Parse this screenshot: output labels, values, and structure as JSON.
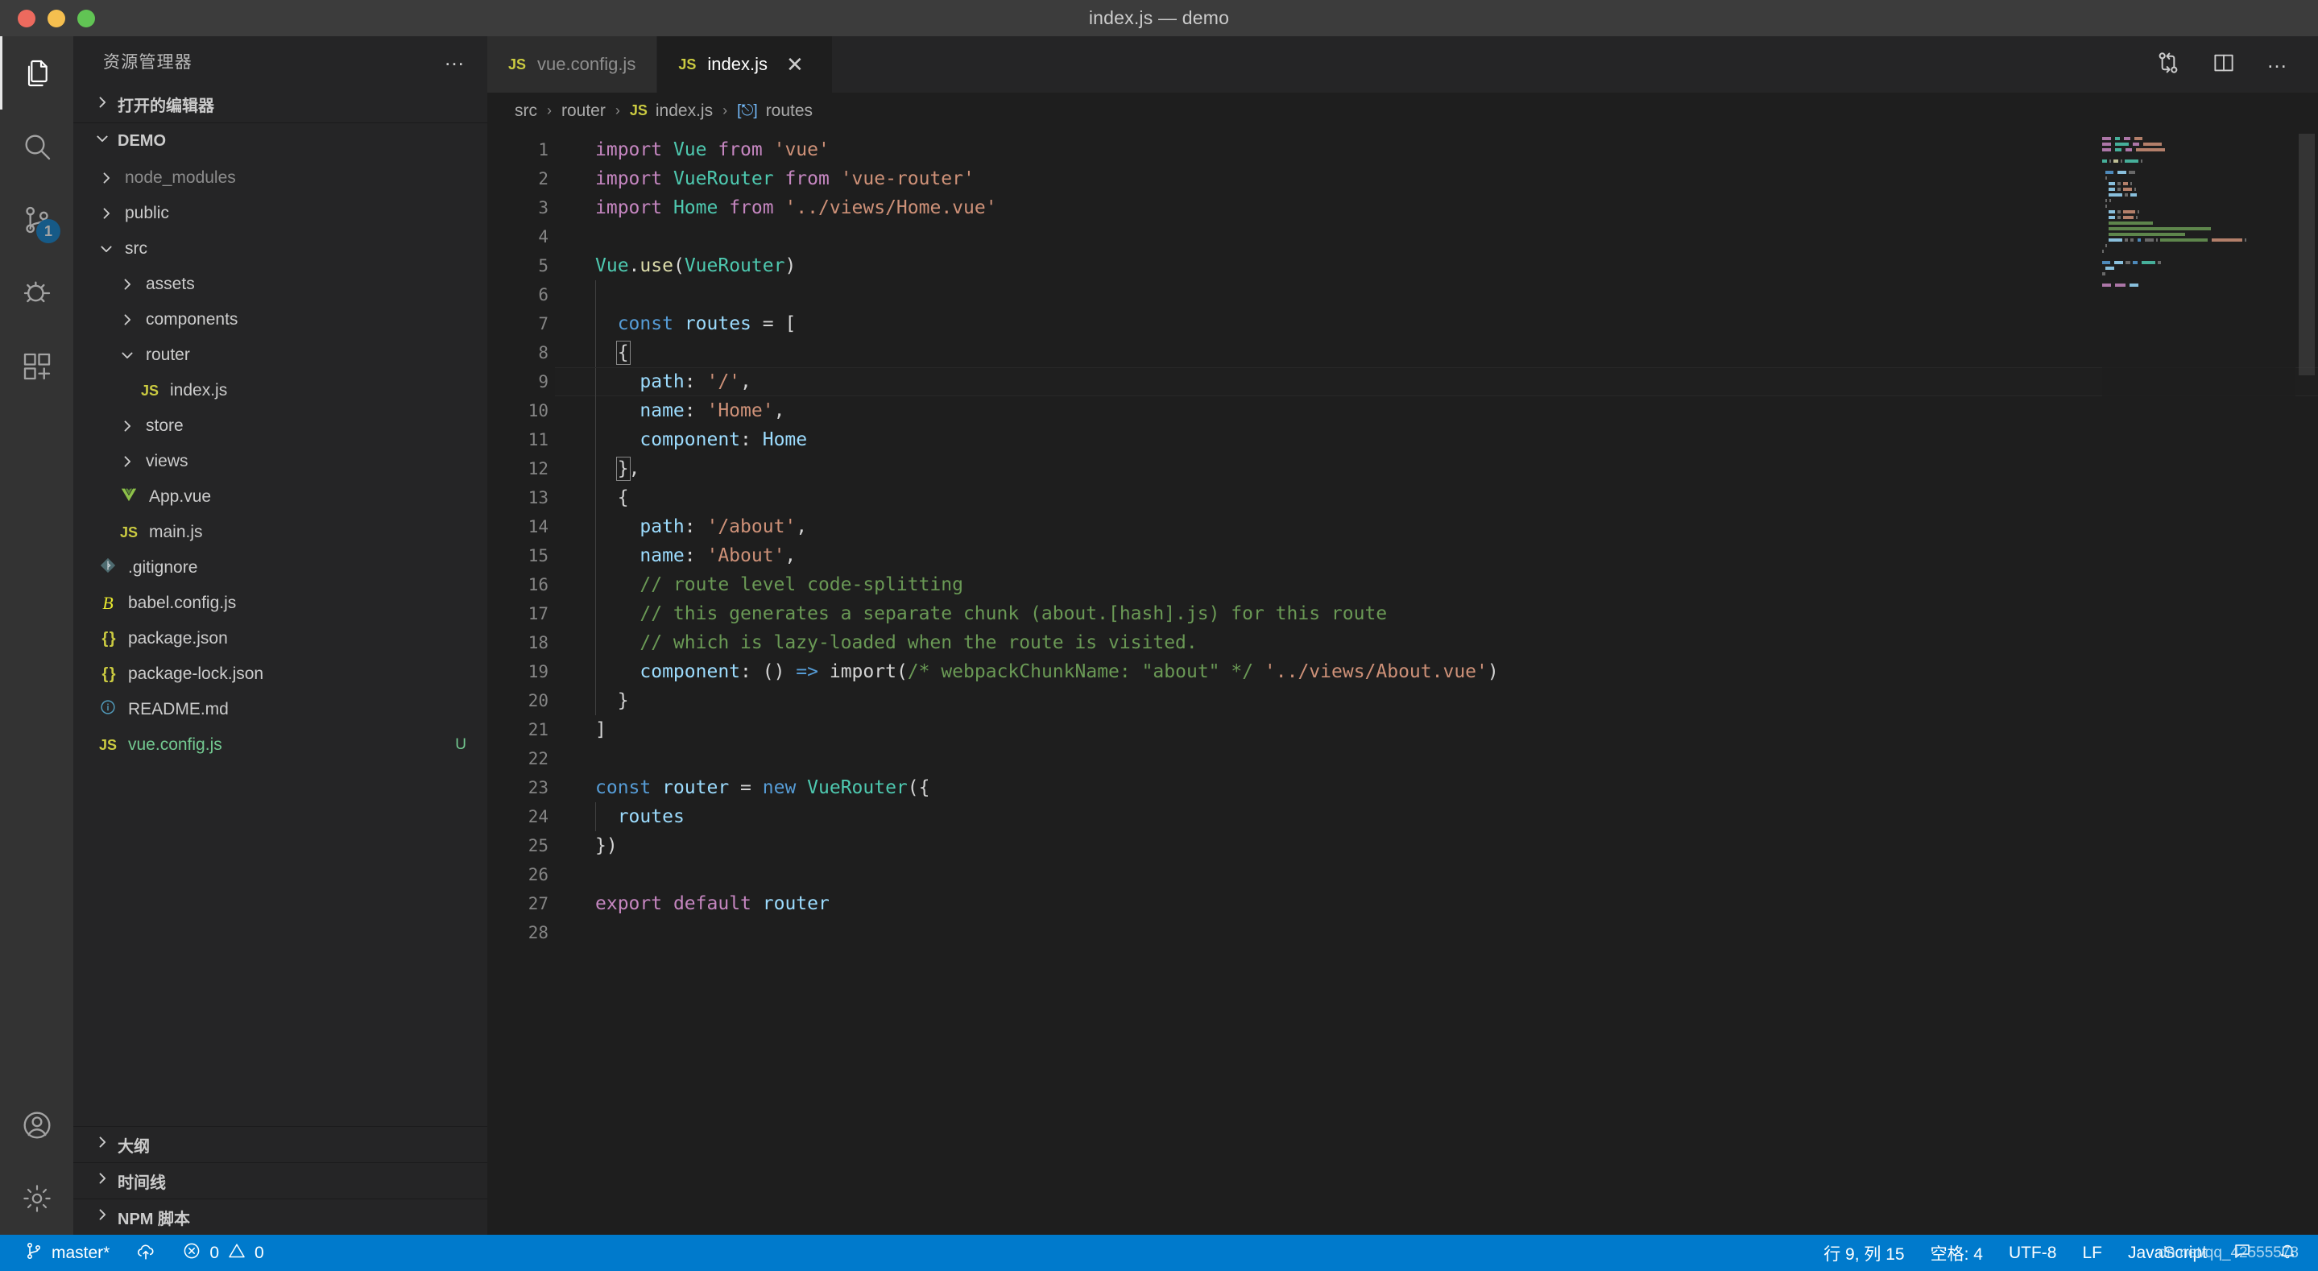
{
  "window": {
    "title": "index.js — demo",
    "traffic_lights": [
      "close-red",
      "minimize-yellow",
      "zoom-green"
    ]
  },
  "activity_bar": {
    "items": [
      {
        "name": "explorer",
        "icon": "files-icon",
        "active": true,
        "badge": null
      },
      {
        "name": "search",
        "icon": "search-icon",
        "active": false,
        "badge": null
      },
      {
        "name": "source-control",
        "icon": "source-control-icon",
        "active": false,
        "badge": "1"
      },
      {
        "name": "run-and-debug",
        "icon": "debug-icon",
        "active": false,
        "badge": null
      },
      {
        "name": "extensions",
        "icon": "extensions-icon",
        "active": false,
        "badge": null
      },
      {
        "name": "accounts",
        "icon": "account-icon",
        "active": false,
        "badge": null
      },
      {
        "name": "manage-settings",
        "icon": "gear-icon",
        "active": false,
        "badge": null
      }
    ]
  },
  "sidebar": {
    "title": "资源管理器",
    "more_actions": "…",
    "open_editors_label": "打开的编辑器",
    "project_label": "DEMO",
    "tree": [
      {
        "label": "node_modules",
        "depth": 1,
        "type": "folder",
        "expanded": false,
        "dim": true,
        "icon": "chevron-right-icon",
        "git": ""
      },
      {
        "label": "public",
        "depth": 1,
        "type": "folder",
        "expanded": false,
        "dim": false,
        "icon": "chevron-right-icon",
        "git": ""
      },
      {
        "label": "src",
        "depth": 1,
        "type": "folder",
        "expanded": true,
        "dim": false,
        "icon": "chevron-down-icon",
        "git": ""
      },
      {
        "label": "assets",
        "depth": 2,
        "type": "folder",
        "expanded": false,
        "dim": false,
        "icon": "chevron-right-icon",
        "git": ""
      },
      {
        "label": "components",
        "depth": 2,
        "type": "folder",
        "expanded": false,
        "dim": false,
        "icon": "chevron-right-icon",
        "git": ""
      },
      {
        "label": "router",
        "depth": 2,
        "type": "folder",
        "expanded": true,
        "dim": false,
        "icon": "chevron-down-icon",
        "git": ""
      },
      {
        "label": "index.js",
        "depth": 3,
        "type": "file",
        "expanded": false,
        "dim": false,
        "icon": "js-file-icon",
        "git": ""
      },
      {
        "label": "store",
        "depth": 2,
        "type": "folder",
        "expanded": false,
        "dim": false,
        "icon": "chevron-right-icon",
        "git": ""
      },
      {
        "label": "views",
        "depth": 2,
        "type": "folder",
        "expanded": false,
        "dim": false,
        "icon": "chevron-right-icon",
        "git": ""
      },
      {
        "label": "App.vue",
        "depth": 2,
        "type": "file",
        "expanded": false,
        "dim": false,
        "icon": "vue-file-icon",
        "git": ""
      },
      {
        "label": "main.js",
        "depth": 2,
        "type": "file",
        "expanded": false,
        "dim": false,
        "icon": "js-file-icon",
        "git": ""
      },
      {
        "label": ".gitignore",
        "depth": 1,
        "type": "file",
        "expanded": false,
        "dim": false,
        "icon": "git-file-icon",
        "git": ""
      },
      {
        "label": "babel.config.js",
        "depth": 1,
        "type": "file",
        "expanded": false,
        "dim": false,
        "icon": "babel-file-icon",
        "git": ""
      },
      {
        "label": "package.json",
        "depth": 1,
        "type": "file",
        "expanded": false,
        "dim": false,
        "icon": "json-file-icon",
        "git": ""
      },
      {
        "label": "package-lock.json",
        "depth": 1,
        "type": "file",
        "expanded": false,
        "dim": false,
        "icon": "json-file-icon",
        "git": ""
      },
      {
        "label": "README.md",
        "depth": 1,
        "type": "file",
        "expanded": false,
        "dim": false,
        "icon": "markdown-file-icon",
        "git": ""
      },
      {
        "label": "vue.config.js",
        "depth": 1,
        "type": "file",
        "expanded": false,
        "dim": false,
        "icon": "js-file-icon",
        "git": "U",
        "untracked": true
      }
    ],
    "bottom_sections": [
      {
        "label": "大纲"
      },
      {
        "label": "时间线"
      },
      {
        "label": "NPM 脚本"
      }
    ]
  },
  "editor": {
    "tabs": [
      {
        "label": "vue.config.js",
        "icon": "js-file-icon",
        "active": false,
        "closable": false
      },
      {
        "label": "index.js",
        "icon": "js-file-icon",
        "active": true,
        "closable": true,
        "close_glyph": "✕"
      }
    ],
    "actions": [
      {
        "name": "split-diff-icon"
      },
      {
        "name": "split-editor-icon"
      },
      {
        "name": "more-actions-icon",
        "glyph": "…"
      }
    ],
    "breadcrumb": [
      {
        "label": "src",
        "icon": null
      },
      {
        "label": "router",
        "icon": null
      },
      {
        "label": "index.js",
        "icon": "js-file-icon"
      },
      {
        "label": "routes",
        "icon": "symbol-variable-icon"
      }
    ],
    "breadcrumb_separator": "›",
    "current_line": 9,
    "lines": [
      {
        "n": 1,
        "indent": 0,
        "tokens": [
          {
            "t": "import",
            "c": "kw"
          },
          {
            "t": " ",
            "c": "pun"
          },
          {
            "t": "Vue",
            "c": "type"
          },
          {
            "t": " ",
            "c": "pun"
          },
          {
            "t": "from",
            "c": "kw"
          },
          {
            "t": " ",
            "c": "pun"
          },
          {
            "t": "'vue'",
            "c": "str"
          }
        ]
      },
      {
        "n": 2,
        "indent": 0,
        "tokens": [
          {
            "t": "import",
            "c": "kw"
          },
          {
            "t": " ",
            "c": "pun"
          },
          {
            "t": "VueRouter",
            "c": "type"
          },
          {
            "t": " ",
            "c": "pun"
          },
          {
            "t": "from",
            "c": "kw"
          },
          {
            "t": " ",
            "c": "pun"
          },
          {
            "t": "'vue-router'",
            "c": "str"
          }
        ]
      },
      {
        "n": 3,
        "indent": 0,
        "tokens": [
          {
            "t": "import",
            "c": "kw"
          },
          {
            "t": " ",
            "c": "pun"
          },
          {
            "t": "Home",
            "c": "type"
          },
          {
            "t": " ",
            "c": "pun"
          },
          {
            "t": "from",
            "c": "kw"
          },
          {
            "t": " ",
            "c": "pun"
          },
          {
            "t": "'../views/Home.vue'",
            "c": "str"
          }
        ]
      },
      {
        "n": 4,
        "indent": 0,
        "tokens": []
      },
      {
        "n": 5,
        "indent": 0,
        "tokens": [
          {
            "t": "Vue",
            "c": "type"
          },
          {
            "t": ".",
            "c": "pun"
          },
          {
            "t": "use",
            "c": "fn"
          },
          {
            "t": "(",
            "c": "pun"
          },
          {
            "t": "VueRouter",
            "c": "type"
          },
          {
            "t": ")",
            "c": "pun"
          }
        ]
      },
      {
        "n": 6,
        "indent": 1,
        "tokens": []
      },
      {
        "n": 7,
        "indent": 1,
        "tokens": [
          {
            "t": "  ",
            "c": "pun"
          },
          {
            "t": "const",
            "c": "blue"
          },
          {
            "t": " ",
            "c": "pun"
          },
          {
            "t": "routes",
            "c": "var"
          },
          {
            "t": " = [",
            "c": "pun"
          }
        ]
      },
      {
        "n": 8,
        "indent": 1,
        "tokens": [
          {
            "t": "  ",
            "c": "pun"
          },
          {
            "t": "{",
            "c": "pun",
            "bracket": true
          }
        ]
      },
      {
        "n": 9,
        "indent": 1,
        "tokens": [
          {
            "t": "    ",
            "c": "pun"
          },
          {
            "t": "path",
            "c": "var"
          },
          {
            "t": ": ",
            "c": "pun"
          },
          {
            "t": "'/'",
            "c": "str"
          },
          {
            "t": ",",
            "c": "pun"
          }
        ]
      },
      {
        "n": 10,
        "indent": 1,
        "tokens": [
          {
            "t": "    ",
            "c": "pun"
          },
          {
            "t": "name",
            "c": "var"
          },
          {
            "t": ": ",
            "c": "pun"
          },
          {
            "t": "'Home'",
            "c": "str"
          },
          {
            "t": ",",
            "c": "pun"
          }
        ]
      },
      {
        "n": 11,
        "indent": 1,
        "tokens": [
          {
            "t": "    ",
            "c": "pun"
          },
          {
            "t": "component",
            "c": "var"
          },
          {
            "t": ": ",
            "c": "pun"
          },
          {
            "t": "Home",
            "c": "var"
          }
        ]
      },
      {
        "n": 12,
        "indent": 1,
        "tokens": [
          {
            "t": "  ",
            "c": "pun"
          },
          {
            "t": "}",
            "c": "pun",
            "bracket": true
          },
          {
            "t": ",",
            "c": "pun"
          }
        ]
      },
      {
        "n": 13,
        "indent": 1,
        "tokens": [
          {
            "t": "  ",
            "c": "pun"
          },
          {
            "t": "{",
            "c": "pun"
          }
        ]
      },
      {
        "n": 14,
        "indent": 1,
        "tokens": [
          {
            "t": "    ",
            "c": "pun"
          },
          {
            "t": "path",
            "c": "var"
          },
          {
            "t": ": ",
            "c": "pun"
          },
          {
            "t": "'/about'",
            "c": "str"
          },
          {
            "t": ",",
            "c": "pun"
          }
        ]
      },
      {
        "n": 15,
        "indent": 1,
        "tokens": [
          {
            "t": "    ",
            "c": "pun"
          },
          {
            "t": "name",
            "c": "var"
          },
          {
            "t": ": ",
            "c": "pun"
          },
          {
            "t": "'About'",
            "c": "str"
          },
          {
            "t": ",",
            "c": "pun"
          }
        ]
      },
      {
        "n": 16,
        "indent": 1,
        "tokens": [
          {
            "t": "    ",
            "c": "pun"
          },
          {
            "t": "// route level code-splitting",
            "c": "cmt"
          }
        ]
      },
      {
        "n": 17,
        "indent": 1,
        "tokens": [
          {
            "t": "    ",
            "c": "pun"
          },
          {
            "t": "// this generates a separate chunk (about.[hash].js) for this route",
            "c": "cmt"
          }
        ]
      },
      {
        "n": 18,
        "indent": 1,
        "tokens": [
          {
            "t": "    ",
            "c": "pun"
          },
          {
            "t": "// which is lazy-loaded when the route is visited.",
            "c": "cmt"
          }
        ]
      },
      {
        "n": 19,
        "indent": 1,
        "tokens": [
          {
            "t": "    ",
            "c": "pun"
          },
          {
            "t": "component",
            "c": "var"
          },
          {
            "t": ": ",
            "c": "pun"
          },
          {
            "t": "()",
            "c": "pun"
          },
          {
            "t": " ",
            "c": "pun"
          },
          {
            "t": "=>",
            "c": "arrow"
          },
          {
            "t": " ",
            "c": "pun"
          },
          {
            "t": "import",
            "c": "pun"
          },
          {
            "t": "(",
            "c": "pun"
          },
          {
            "t": "/* webpackChunkName: \"about\" */",
            "c": "cmt"
          },
          {
            "t": " ",
            "c": "pun"
          },
          {
            "t": "'../views/About.vue'",
            "c": "str"
          },
          {
            "t": ")",
            "c": "pun"
          }
        ]
      },
      {
        "n": 20,
        "indent": 1,
        "tokens": [
          {
            "t": "  ",
            "c": "pun"
          },
          {
            "t": "}",
            "c": "pun"
          }
        ]
      },
      {
        "n": 21,
        "indent": 0,
        "tokens": [
          {
            "t": "]",
            "c": "pun"
          }
        ]
      },
      {
        "n": 22,
        "indent": 0,
        "tokens": []
      },
      {
        "n": 23,
        "indent": 0,
        "tokens": [
          {
            "t": "const",
            "c": "blue"
          },
          {
            "t": " ",
            "c": "pun"
          },
          {
            "t": "router",
            "c": "var"
          },
          {
            "t": " = ",
            "c": "pun"
          },
          {
            "t": "new",
            "c": "blue"
          },
          {
            "t": " ",
            "c": "pun"
          },
          {
            "t": "VueRouter",
            "c": "type"
          },
          {
            "t": "({",
            "c": "pun"
          }
        ]
      },
      {
        "n": 24,
        "indent": 1,
        "tokens": [
          {
            "t": "  ",
            "c": "pun"
          },
          {
            "t": "routes",
            "c": "var"
          }
        ]
      },
      {
        "n": 25,
        "indent": 0,
        "tokens": [
          {
            "t": "})",
            "c": "pun"
          }
        ]
      },
      {
        "n": 26,
        "indent": 0,
        "tokens": []
      },
      {
        "n": 27,
        "indent": 0,
        "tokens": [
          {
            "t": "export",
            "c": "kw"
          },
          {
            "t": " ",
            "c": "pun"
          },
          {
            "t": "default",
            "c": "kw"
          },
          {
            "t": " ",
            "c": "pun"
          },
          {
            "t": "router",
            "c": "var"
          }
        ]
      },
      {
        "n": 28,
        "indent": 0,
        "tokens": []
      }
    ]
  },
  "status_bar": {
    "branch": "master*",
    "sync_icon": "cloud-upload-icon",
    "errors": "0",
    "warnings": "0",
    "cursor_position": "行 9, 列 15",
    "indentation": "空格: 4",
    "encoding": "UTF-8",
    "eol": "LF",
    "language": "JavaScript",
    "feedback_icon": "feedback-icon",
    "bell_icon": "bell-icon",
    "watermark": "dn.net/qq_42555578"
  },
  "colors": {
    "accent": "#007acc",
    "titlebar_bg": "#3c3c3c",
    "sidebar_bg": "#252526",
    "activitybar_bg": "#333333",
    "editor_bg": "#1e1e1e",
    "tab_inactive_bg": "#2d2d2d",
    "badge_bg": "#007acc",
    "js_yellow": "#cbcb41",
    "vue_green": "#81c784",
    "git_green": "#73c991"
  }
}
